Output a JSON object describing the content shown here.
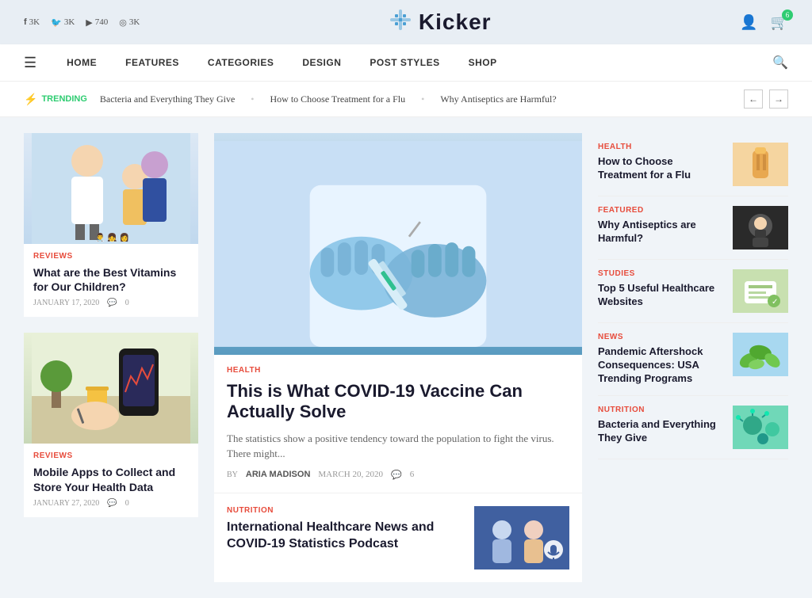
{
  "topBar": {
    "social": [
      {
        "network": "facebook",
        "symbol": "f",
        "count": "3K"
      },
      {
        "network": "twitter",
        "symbol": "t",
        "count": "3K"
      },
      {
        "network": "youtube",
        "symbol": "▶",
        "count": "740"
      },
      {
        "network": "instagram",
        "symbol": "◎",
        "count": "3K"
      }
    ]
  },
  "logo": {
    "icon": "✦",
    "text": "Kicker"
  },
  "nav": {
    "links": [
      "HOME",
      "FEATURES",
      "CATEGORIES",
      "DESIGN",
      "POST STYLES",
      "SHOP"
    ]
  },
  "trending": {
    "label": "TRENDING",
    "items": [
      "Bacteria and Everything They Give",
      "How to Choose Treatment for a Flu",
      "Why Antiseptics are Harmful?"
    ]
  },
  "leftCol": {
    "articles": [
      {
        "category": "REVIEWS",
        "title": "What are the Best Vitamins for Our Children?",
        "date": "JANUARY 17, 2020",
        "comments": "0",
        "imgType": "doctor"
      },
      {
        "category": "REVIEWS",
        "title": "Mobile Apps to Collect and Store Your Health Data",
        "date": "JANUARY 27, 2020",
        "comments": "0",
        "imgType": "phone"
      }
    ]
  },
  "centerCol": {
    "heroArticle": {
      "category": "HEALTH",
      "title": "This is What COVID-19 Vaccine Can Actually Solve",
      "excerpt": "The statistics show a positive tendency toward the population to fight the virus. There might...",
      "author": "ARIA MADISON",
      "date": "MARCH 20, 2020",
      "comments": "6"
    },
    "secondArticle": {
      "category": "NUTRITION",
      "title": "International Healthcare News and COVID-19 Statistics Podcast"
    }
  },
  "rightCol": {
    "items": [
      {
        "category": "HEALTH",
        "title": "How to Choose Treatment for a Flu",
        "thumbType": "thumb-1"
      },
      {
        "category": "FEATURED",
        "title": "Why Antiseptics are Harmful?",
        "thumbType": "thumb-2"
      },
      {
        "category": "STUDIES",
        "title": "Top 5 Useful Healthcare Websites",
        "thumbType": "thumb-3"
      },
      {
        "category": "NEWS",
        "title": "Pandemic Aftershock Consequences: USA Trending Programs",
        "thumbType": "thumb-4"
      },
      {
        "category": "NUTRITION",
        "title": "Bacteria and Everything They Give",
        "thumbType": "thumb-5"
      }
    ]
  },
  "colors": {
    "accent": "#e74c3c",
    "green": "#2ecc71",
    "navBg": "#ffffff",
    "headerBg": "#e8eef4"
  }
}
